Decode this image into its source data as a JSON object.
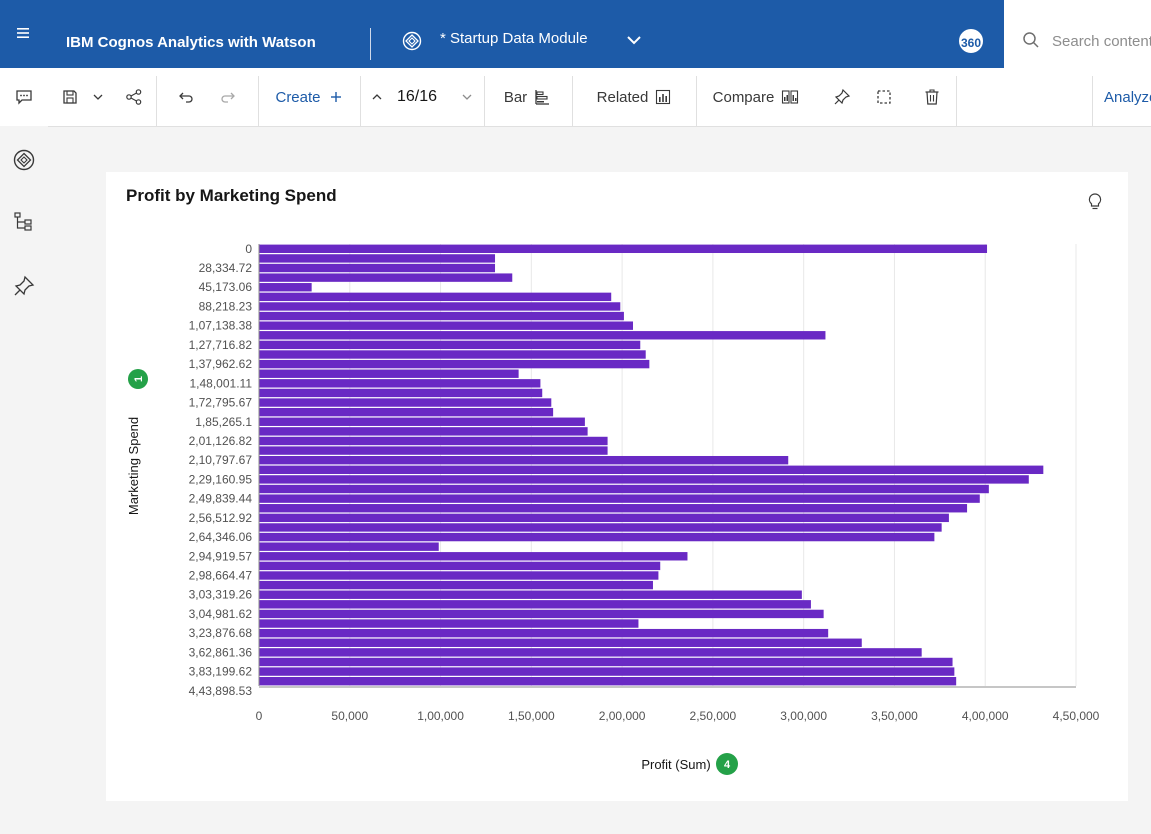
{
  "header": {
    "menu_icon": "hamburger-icon",
    "app_title": "IBM Cognos Analytics with Watson",
    "module_name": "* Startup Data Module",
    "badge": "360",
    "search_placeholder": "Search content"
  },
  "toolbar": {
    "create_label": "Create",
    "page_counter": "16/16",
    "bar_label": "Bar",
    "related_label": "Related",
    "compare_label": "Compare",
    "analyze_label": "Analyze"
  },
  "chart": {
    "insight_icon": "lightbulb-icon",
    "y_badge": "1",
    "x_badge": "4",
    "bar_color": "#6929c4"
  },
  "chart_data": {
    "type": "bar",
    "orientation": "horizontal",
    "title": "Profit by Marketing Spend",
    "xlabel": "Profit (Sum)",
    "ylabel": "Marketing Spend",
    "xlim": [
      0,
      450000
    ],
    "x_ticks": [
      "0",
      "50,000",
      "1,00,000",
      "1,50,000",
      "2,00,000",
      "2,50,000",
      "3,00,000",
      "3,50,000",
      "4,00,000",
      "4,50,000"
    ],
    "y_tick_labels": [
      "0",
      "28,334.72",
      "45,173.06",
      "88,218.23",
      "1,07,138.38",
      "1,27,716.82",
      "1,37,962.62",
      "1,48,001.11",
      "1,72,795.67",
      "1,85,265.1",
      "2,01,126.82",
      "2,10,797.67",
      "2,29,160.95",
      "2,49,839.44",
      "2,56,512.92",
      "2,64,346.06",
      "2,94,919.57",
      "2,98,664.47",
      "3,03,319.26",
      "3,04,981.62",
      "3,23,876.68",
      "3,62,861.36",
      "3,83,199.62",
      "4,43,898.53"
    ],
    "values": [
      401000,
      130000,
      130000,
      139500,
      29000,
      194000,
      199000,
      201000,
      206000,
      312000,
      210000,
      213000,
      215000,
      143000,
      155000,
      156000,
      161000,
      162000,
      179500,
      181000,
      192000,
      192000,
      291500,
      432000,
      424000,
      402000,
      397000,
      390000,
      380000,
      376000,
      372000,
      99000,
      236000,
      221000,
      220000,
      217000,
      299000,
      304000,
      311000,
      209000,
      313500,
      332000,
      365000,
      382000,
      383000,
      384000
    ]
  }
}
